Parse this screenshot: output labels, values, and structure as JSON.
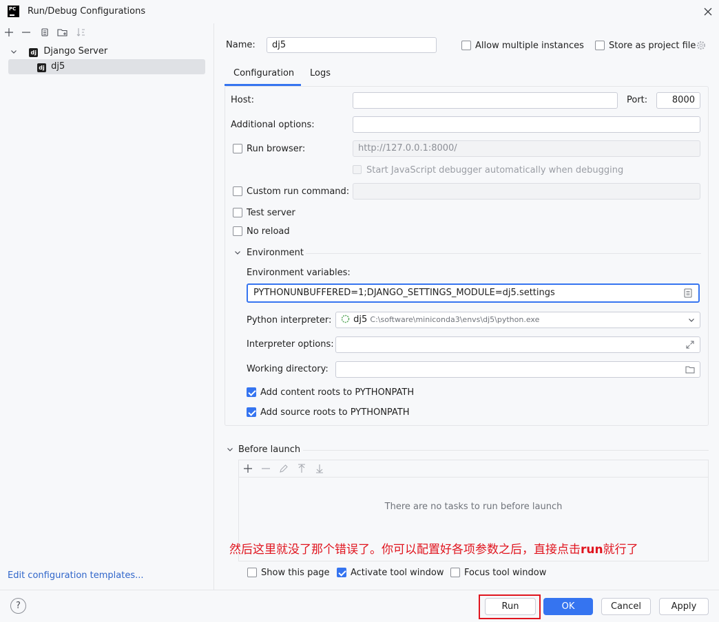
{
  "window": {
    "title": "Run/Debug Configurations",
    "logo_text": "PC"
  },
  "tree": {
    "group_label": "Django Server",
    "item_label": "dj5",
    "badge_text": "dj"
  },
  "left_footer": {
    "edit_templates": "Edit configuration templates..."
  },
  "form": {
    "name_label": "Name:",
    "name_value": "dj5",
    "allow_multiple": "Allow multiple instances",
    "store_as_project": "Store as project file",
    "tabs": [
      {
        "label": "Configuration"
      },
      {
        "label": "Logs"
      }
    ],
    "host_label": "Host:",
    "host_value": "",
    "port_label": "Port:",
    "port_value": "8000",
    "additional_label": "Additional options:",
    "additional_value": "",
    "run_browser_label": "Run browser:",
    "run_browser_url": "http://127.0.0.1:8000/",
    "js_debugger_label": "Start JavaScript debugger automatically when debugging",
    "custom_cmd_label": "Custom run command:",
    "test_server_label": "Test server",
    "no_reload_label": "No reload",
    "environment_section": "Environment",
    "env_vars_label": "Environment variables:",
    "env_vars_value": "PYTHONUNBUFFERED=1;DJANGO_SETTINGS_MODULE=dj5.settings",
    "interpreter_label": "Python interpreter:",
    "interpreter_name": "dj5",
    "interpreter_path": "C:\\software\\miniconda3\\envs\\dj5\\python.exe",
    "interp_options_label": "Interpreter options:",
    "working_dir_label": "Working directory:",
    "content_roots_label": "Add content roots to PYTHONPATH",
    "source_roots_label": "Add source roots to PYTHONPATH"
  },
  "before_launch": {
    "title": "Before launch",
    "empty_text": "There are no tasks to run before launch"
  },
  "annotation": {
    "text_before": "然后这里就没了那个错误了。你可以配置好各项参数之后，直接点击",
    "text_bold": "run",
    "text_after": "就行了"
  },
  "options": {
    "show_page": "Show this page",
    "activate_tool": "Activate tool window",
    "focus_tool": "Focus tool window"
  },
  "buttons": {
    "help": "?",
    "run": "Run",
    "ok": "OK",
    "cancel": "Cancel",
    "apply": "Apply"
  },
  "colors": {
    "accent": "#3574f0",
    "annotation_red": "#e0141e",
    "link": "#2f65ca"
  }
}
